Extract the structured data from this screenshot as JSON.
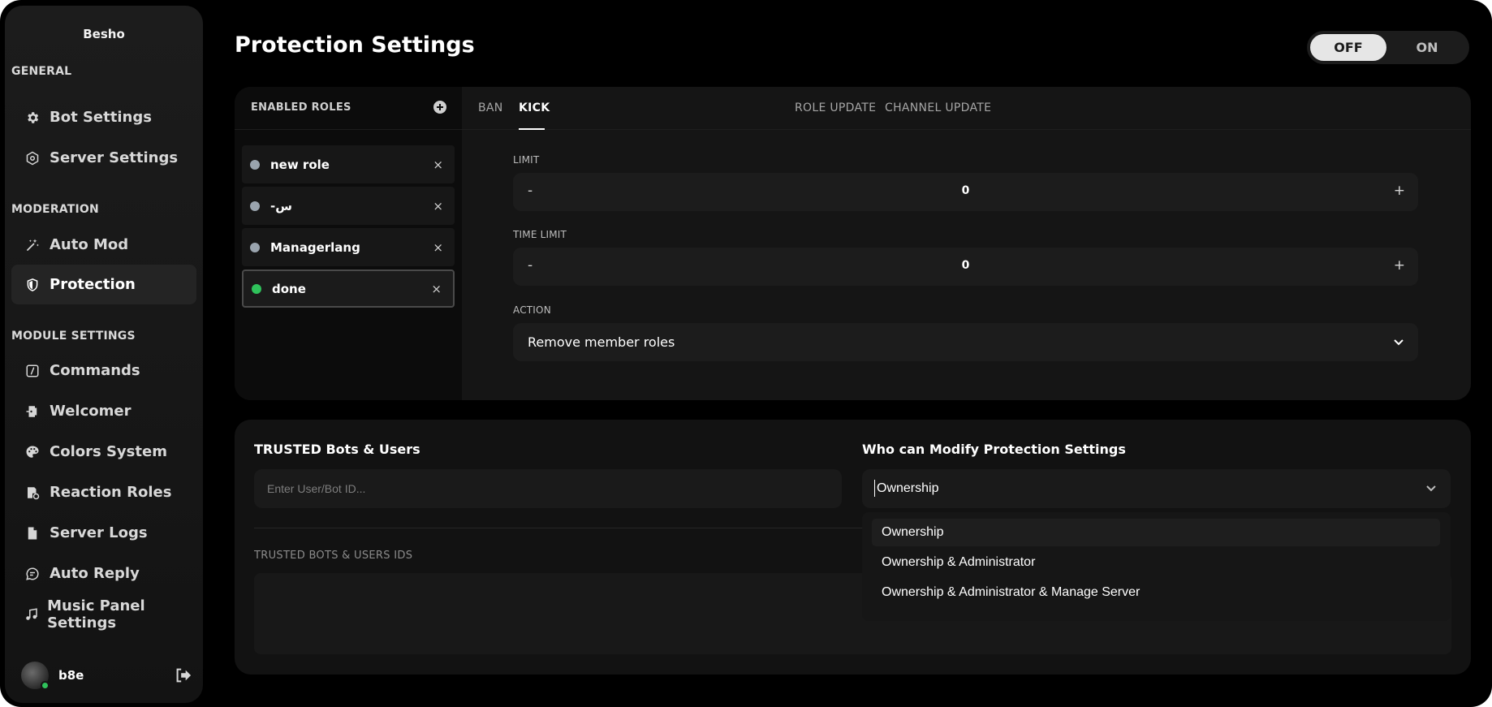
{
  "sidebar": {
    "brand": "Besho",
    "sections": [
      {
        "title": "GENERAL",
        "items": [
          {
            "label": "Bot Settings",
            "icon": "gear-icon"
          },
          {
            "label": "Server Settings",
            "icon": "hexagon-icon"
          }
        ]
      },
      {
        "title": "MODERATION",
        "items": [
          {
            "label": "Auto Mod",
            "icon": "magic-wand-icon"
          },
          {
            "label": "Protection",
            "icon": "shield-icon",
            "active": true
          }
        ]
      },
      {
        "title": "MODULE SETTINGS",
        "items": [
          {
            "label": "Commands",
            "icon": "command-icon"
          },
          {
            "label": "Welcomer",
            "icon": "welcome-door-icon"
          },
          {
            "label": "Colors System",
            "icon": "palette-icon"
          },
          {
            "label": "Reaction Roles",
            "icon": "reaction-roles-icon"
          },
          {
            "label": "Server Logs",
            "icon": "file-icon"
          },
          {
            "label": "Auto Reply",
            "icon": "chat-bubble-icon"
          },
          {
            "label": "Music Panel Settings",
            "icon": "music-note-icon"
          }
        ]
      }
    ],
    "user": {
      "name": "b8e",
      "status_color": "#2fc25b"
    }
  },
  "header": {
    "title": "Protection Settings",
    "toggle": {
      "off": "OFF",
      "on": "ON",
      "value": "OFF"
    }
  },
  "roles": {
    "heading": "ENABLED ROLES",
    "items": [
      {
        "name": "new role",
        "color": "#9aa4ae",
        "remove": "×"
      },
      {
        "name": "-س",
        "color": "#9aa4ae",
        "remove": "×"
      },
      {
        "name": "Managerlang",
        "color": "#9aa4ae",
        "remove": "×"
      },
      {
        "name": "done",
        "color": "#2fc25b",
        "remove": "×",
        "selected": true
      }
    ]
  },
  "tabs": {
    "items": [
      "BAN",
      "KICK",
      "ROLE UPDATE",
      "CHANNEL UPDATE"
    ],
    "active": "KICK"
  },
  "settings": {
    "limit": {
      "label": "LIMIT",
      "value": "0",
      "minus": "-",
      "plus": "+"
    },
    "time_limit": {
      "label": "TIME LIMIT",
      "value": "0",
      "minus": "-",
      "plus": "+"
    },
    "action": {
      "label": "ACTION",
      "value": "Remove member roles"
    }
  },
  "trusted": {
    "title": "TRUSTED Bots & Users",
    "placeholder": "Enter User/Bot ID...",
    "ids_label": "TRUSTED BOTS & USERS IDS"
  },
  "modify": {
    "title": "Who can Modify Protection Settings",
    "value": "Ownership",
    "options": [
      "Ownership",
      "Ownership & Administrator",
      "Ownership & Administrator & Manage Server"
    ]
  },
  "colors": {
    "background": "#000000",
    "panel": "#151515",
    "accent_online": "#2fc25b",
    "toggle_active": "#e6e6e6"
  }
}
